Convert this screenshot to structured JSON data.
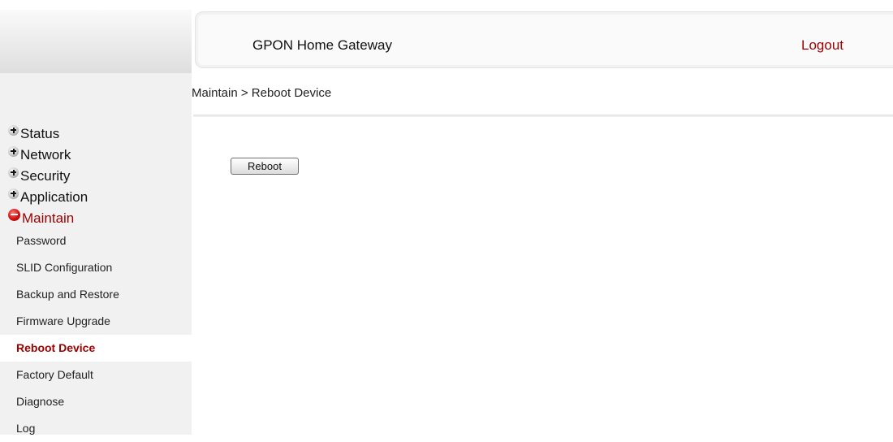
{
  "header": {
    "title": "GPON Home Gateway",
    "logout_label": "Logout"
  },
  "breadcrumb": "Maintain > Reboot Device",
  "sidebar": {
    "groups": [
      {
        "label": "Status",
        "expanded": false
      },
      {
        "label": "Network",
        "expanded": false
      },
      {
        "label": "Security",
        "expanded": false
      },
      {
        "label": "Application",
        "expanded": false
      },
      {
        "label": "Maintain",
        "expanded": true
      }
    ],
    "maintain_items": [
      {
        "label": "Password",
        "selected": false
      },
      {
        "label": "SLID Configuration",
        "selected": false
      },
      {
        "label": "Backup and Restore",
        "selected": false
      },
      {
        "label": "Firmware Upgrade",
        "selected": false
      },
      {
        "label": "Reboot Device",
        "selected": true
      },
      {
        "label": "Factory Default",
        "selected": false
      },
      {
        "label": "Diagnose",
        "selected": false
      },
      {
        "label": "Log",
        "selected": false
      }
    ]
  },
  "main": {
    "reboot_button_label": "Reboot"
  },
  "colors": {
    "accent": "#9b0000",
    "sidebar_bg": "#f1f1f1"
  },
  "icons": {
    "collapsed": "plus-icon",
    "expanded": "minus-icon"
  }
}
